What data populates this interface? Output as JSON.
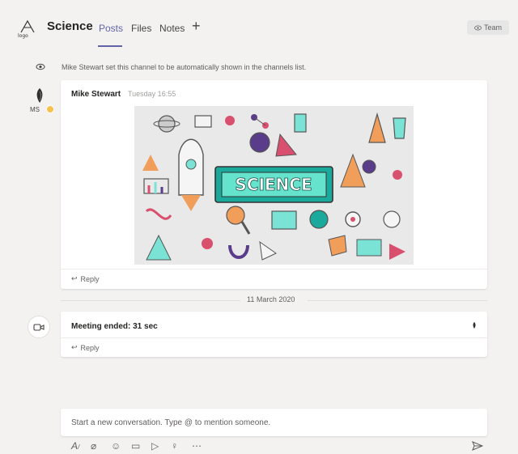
{
  "header": {
    "channel_name": "Science",
    "tabs": [
      {
        "label": "Posts",
        "active": true
      },
      {
        "label": "Files",
        "active": false
      },
      {
        "label": "Notes",
        "active": false
      }
    ],
    "add_tab_icon": "plus-icon",
    "team_button_label": "Team"
  },
  "system_message": {
    "icon": "eye-icon",
    "text": "Mike Stewart set this channel to be automatically shown in the channels list."
  },
  "post": {
    "author": "Mike Stewart",
    "time": "Tuesday 16:55",
    "avatar_initials": "MS",
    "presence_color": "#f8c14b",
    "image_text": "SCIENCE",
    "reply_label": "Reply"
  },
  "date_separator": "11 March 2020",
  "meeting": {
    "icon": "meeting-camera-icon",
    "title": "Meeting ended: 31 sec",
    "reply_label": "Reply"
  },
  "compose": {
    "placeholder": "Start a new conversation. Type @ to mention someone."
  },
  "toolbar_icons": [
    "format-icon",
    "attach-icon",
    "emoji-icon",
    "meet-now-icon",
    "stream-icon",
    "praise-icon",
    "more-icon",
    "send-icon"
  ],
  "colors": {
    "accent": "#6264a7",
    "background": "#f3f2f1",
    "card": "#ffffff"
  }
}
